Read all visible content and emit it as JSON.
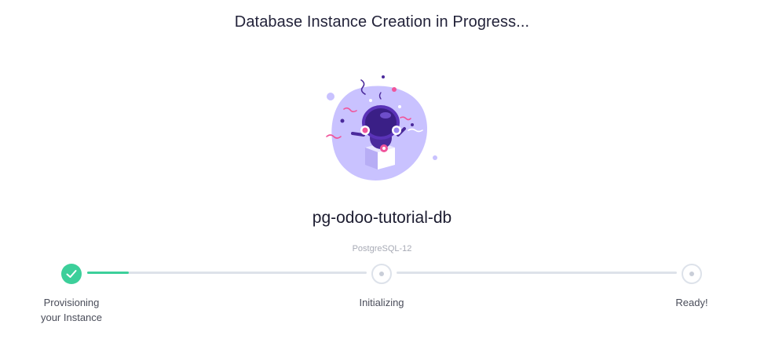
{
  "header": {
    "title": "Database Instance Creation in Progress..."
  },
  "instance": {
    "name": "pg-odoo-tutorial-db",
    "engine": "PostgreSQL-12"
  },
  "progress": {
    "steps": [
      {
        "label_line1": "Provisioning",
        "label_line2": "your Instance",
        "status": "complete",
        "icon": "check-icon"
      },
      {
        "label_line1": "Initializing",
        "status": "pending",
        "icon": "dot-icon"
      },
      {
        "label_line1": "Ready!",
        "status": "pending",
        "icon": "dot-icon"
      }
    ],
    "segment_fill": [
      0.15,
      0.0
    ]
  },
  "illustration": {
    "icon": "robot-in-gift-box-celebration-icon"
  },
  "colors": {
    "accent_green": "#3ccf9a",
    "track_gray": "#dde2ea",
    "blob_purple": "#c9c2ff",
    "robot_purple": "#4b2a9c",
    "confetti_pink": "#f0559b"
  }
}
